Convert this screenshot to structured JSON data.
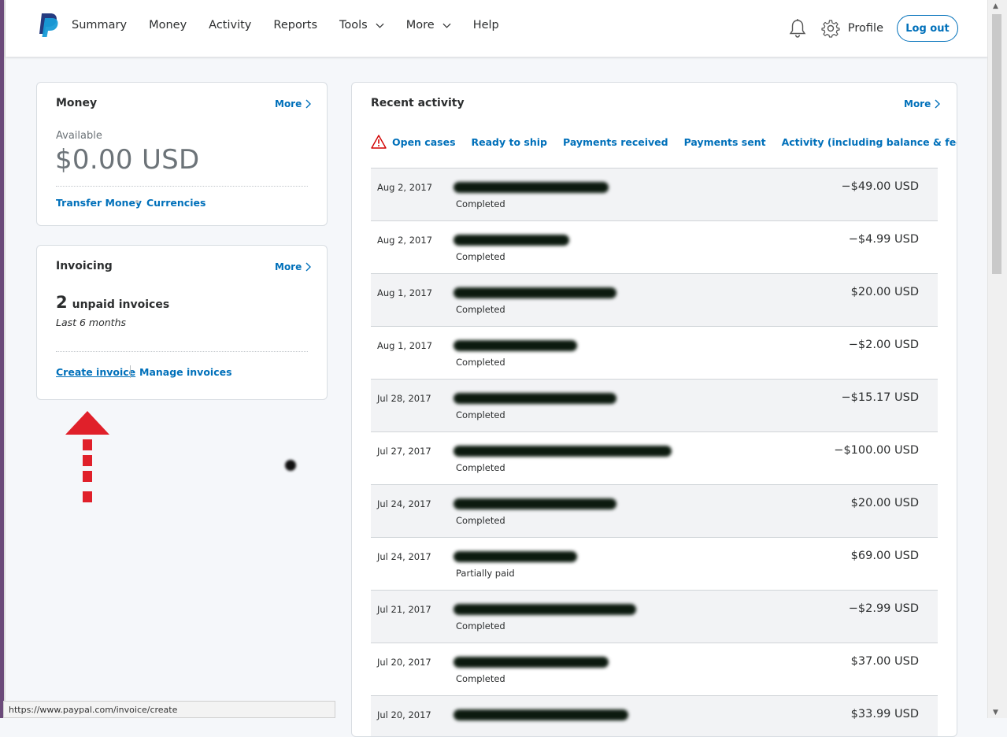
{
  "header": {
    "nav": [
      {
        "label": "Summary",
        "dropdown": false
      },
      {
        "label": "Money",
        "dropdown": false
      },
      {
        "label": "Activity",
        "dropdown": false
      },
      {
        "label": "Reports",
        "dropdown": false
      },
      {
        "label": "Tools",
        "dropdown": true
      },
      {
        "label": "More",
        "dropdown": true
      },
      {
        "label": "Help",
        "dropdown": false
      }
    ],
    "profile_label": "Profile",
    "logout_label": "Log out",
    "icons": [
      "paypal-logo",
      "bell-icon",
      "gear-icon"
    ]
  },
  "money_card": {
    "title": "Money",
    "more_label": "More",
    "available_label": "Available",
    "balance": "$0.00 USD",
    "transfer_label": "Transfer Money",
    "currencies_label": "Currencies"
  },
  "invoicing_card": {
    "title": "Invoicing",
    "more_label": "More",
    "unpaid_count": "2",
    "unpaid_label": "unpaid invoices",
    "period": "Last 6 months",
    "create_label": "Create invoice",
    "manage_label": "Manage invoices"
  },
  "activity": {
    "title": "Recent activity",
    "more_label": "More",
    "filters": [
      "Open cases",
      "Ready to ship",
      "Payments received",
      "Payments sent",
      "Activity (including balance & fees)"
    ],
    "rows": [
      {
        "date": "Aug 2, 2017",
        "status": "Completed",
        "amount": "−$49.00 USD"
      },
      {
        "date": "Aug 2, 2017",
        "status": "Completed",
        "amount": "−$4.99 USD"
      },
      {
        "date": "Aug 1, 2017",
        "status": "Completed",
        "amount": "$20.00 USD"
      },
      {
        "date": "Aug 1, 2017",
        "status": "Completed",
        "amount": "−$2.00 USD"
      },
      {
        "date": "Jul 28, 2017",
        "status": "Completed",
        "amount": "−$15.17 USD"
      },
      {
        "date": "Jul 27, 2017",
        "status": "Completed",
        "amount": "−$100.00 USD"
      },
      {
        "date": "Jul 24, 2017",
        "status": "Completed",
        "amount": "$20.00 USD"
      },
      {
        "date": "Jul 24, 2017",
        "status": "Partially paid",
        "amount": "$69.00 USD"
      },
      {
        "date": "Jul 21, 2017",
        "status": "Completed",
        "amount": "−$2.99 USD"
      },
      {
        "date": "Jul 20, 2017",
        "status": "Completed",
        "amount": "$37.00 USD"
      },
      {
        "date": "Jul 20, 2017",
        "status": "",
        "amount": "$33.99 USD"
      }
    ]
  },
  "statusbar": {
    "url": "https://www.paypal.com/invoice/create"
  },
  "colors": {
    "link_blue": "#0070ba",
    "annotation_red": "#e0202a"
  }
}
